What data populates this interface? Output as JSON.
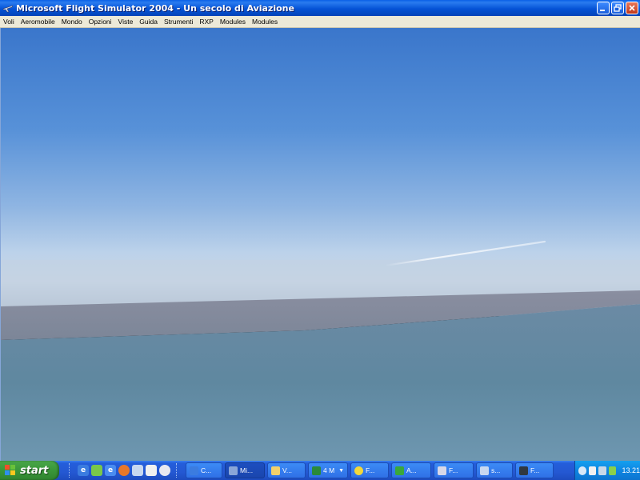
{
  "window": {
    "title": "Microsoft Flight Simulator 2004 - Un secolo di Aviazione"
  },
  "menu": [
    {
      "label": "Voli"
    },
    {
      "label": "Aeromobile"
    },
    {
      "label": "Mondo"
    },
    {
      "label": "Opzioni"
    },
    {
      "label": "Viste"
    },
    {
      "label": "Guida"
    },
    {
      "label": "Strumenti"
    },
    {
      "label": "RXP"
    },
    {
      "label": "Modules"
    },
    {
      "label": "Modules"
    }
  ],
  "taskbar": {
    "start_label": "start",
    "tasks": [
      {
        "label": "C...",
        "icon": "ie-icon",
        "color": "#3b7ce0"
      },
      {
        "label": "Mi...",
        "icon": "flightsim-icon",
        "color": "#8aa6d8",
        "active": true
      },
      {
        "label": "V...",
        "icon": "folder-icon",
        "color": "#f2d06a"
      },
      {
        "label": "4 M",
        "icon": "excel-icon",
        "color": "#2a8a3a"
      },
      {
        "label": "F...",
        "icon": "sun-icon",
        "color": "#f2d83a"
      },
      {
        "label": "A...",
        "icon": "tree-icon",
        "color": "#3aa83a"
      },
      {
        "label": "F...",
        "icon": "plane-icon",
        "color": "#d8d8e8"
      },
      {
        "label": "s...",
        "icon": "document-icon",
        "color": "#c8d8f0"
      },
      {
        "label": "F...",
        "icon": "monitor-icon",
        "color": "#303840"
      }
    ],
    "clock": "13.21"
  },
  "colors": {
    "sky_top": "#3c79cc",
    "sky_horizon": "#b6cde6",
    "sea": "#6a8fa6"
  }
}
